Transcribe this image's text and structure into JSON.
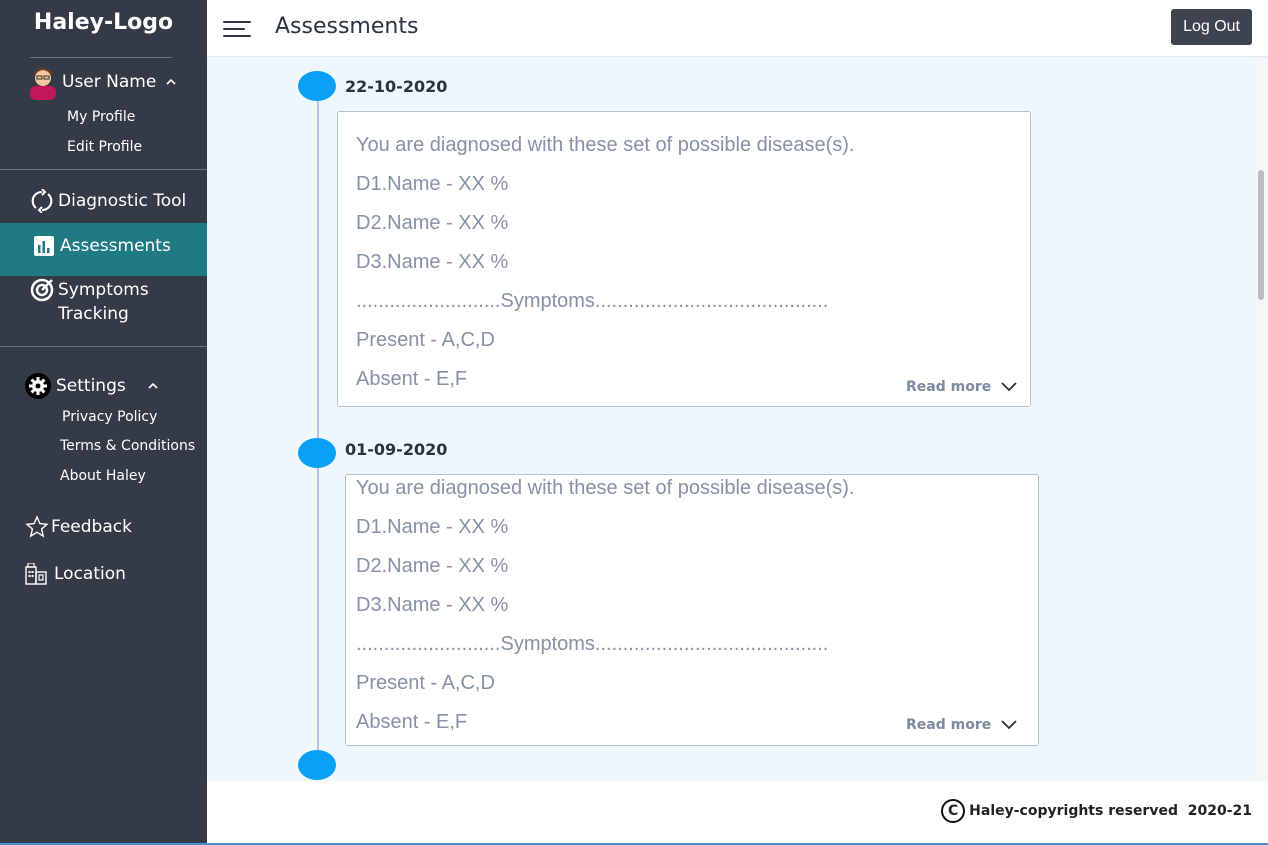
{
  "sidebar": {
    "logo": "Haley-Logo",
    "user": {
      "name": "User Name",
      "caret": "^",
      "links": [
        "My Profile",
        "Edit Profile"
      ]
    },
    "nav": {
      "diagnostic": {
        "label": "Diagnostic Tool",
        "icon": "refresh-icon"
      },
      "assessments": {
        "label": "Assessments",
        "icon": "bar-chart-icon"
      },
      "symptoms_line1": "Symptoms",
      "symptoms_line2": "Tracking",
      "symptoms_icon": "target-icon",
      "settings": {
        "label": "Settings",
        "icon": "gear-icon",
        "caret": "^"
      },
      "settings_links": [
        "Privacy Policy",
        "Terms & Conditions",
        "About Haley"
      ],
      "feedback": {
        "label": "Feedback",
        "icon": "star-icon"
      },
      "location": {
        "label": "Location",
        "icon": "building-icon"
      }
    }
  },
  "header": {
    "title": "Assessments",
    "logout_label": "Log Out"
  },
  "assessments": [
    {
      "date": "22-10-2020",
      "lines": [
        "You are diagnosed with these set of possible disease(s).",
        "D1.Name - XX %",
        "D2.Name - XX %",
        "D3.Name - XX %",
        "..........................Symptoms..........................................",
        "Present -  A,C,D",
        "Absent -  E,F"
      ],
      "read_more": "Read more"
    },
    {
      "date": "01-09-2020",
      "lines": [
        "You are diagnosed with these set of possible disease(s).",
        "D1.Name - XX %",
        "D2.Name - XX %",
        "D3.Name - XX %",
        "..........................Symptoms..........................................",
        "Present -  A,C,D",
        "Absent -  E,F"
      ],
      "read_more": "Read more"
    }
  ],
  "footer": {
    "copyright_symbol": "C",
    "copyright_text": "Haley-copyrights reserved  2020-21"
  },
  "colors": {
    "sidebar_bg": "#343b47",
    "active_bg": "#1f7a84",
    "timeline_dot": "#0aa0f5",
    "main_bg": "#eef7fb"
  }
}
